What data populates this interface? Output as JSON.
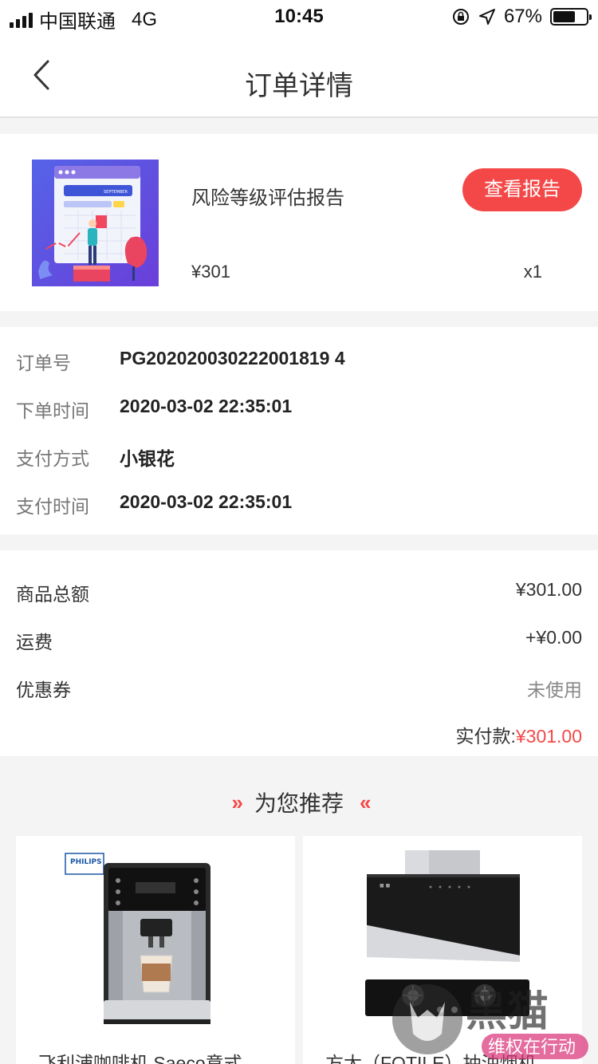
{
  "status_bar": {
    "carrier": "中国联通",
    "network": "4G",
    "time": "10:45",
    "battery": "67%",
    "battery_level": 0.67
  },
  "nav": {
    "title": "订单详情"
  },
  "product": {
    "name": "风险等级评估报告",
    "view_button": "查看报告",
    "price": "¥301",
    "qty": "x1",
    "thumb_caption": "SEPTEMBER"
  },
  "order_info": [
    {
      "label": "订单号",
      "value": "PG202020030222001819 4"
    },
    {
      "label": "下单时间",
      "value": "2020-03-02 22:35:01"
    },
    {
      "label": "支付方式",
      "value": "小银花"
    },
    {
      "label": "支付时间",
      "value": "2020-03-02 22:35:01"
    }
  ],
  "amounts": [
    {
      "label": "商品总额",
      "value": "¥301.00"
    },
    {
      "label": "运费",
      "value": "+¥0.00"
    },
    {
      "label": "优惠券",
      "value": "未使用"
    }
  ],
  "total": {
    "label": "实付款:",
    "value": "¥301.00"
  },
  "recommend": {
    "title": "为您推荐",
    "items": [
      {
        "name": "飞利浦咖啡机 Saeco意式",
        "brand": "PHILIPS"
      },
      {
        "name": "方太（FOTILE）抽油烟机"
      }
    ]
  },
  "watermark": {
    "text": "黑猫",
    "subtext": "维权在行动"
  }
}
